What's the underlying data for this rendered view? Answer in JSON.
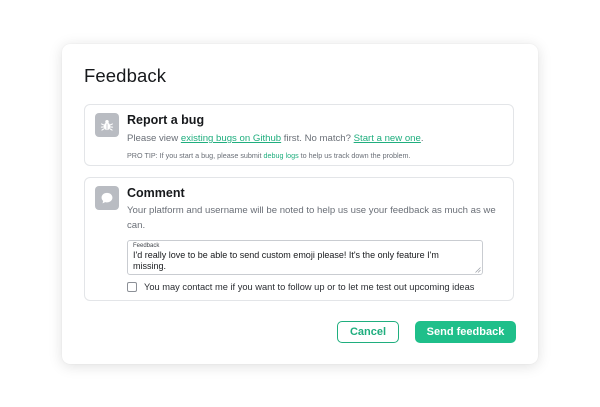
{
  "dialog": {
    "title": "Feedback"
  },
  "bug_card": {
    "icon": "bug-icon",
    "title": "Report a bug",
    "line_prefix": "Please view ",
    "existing_link": "existing bugs on Github",
    "line_middle": " first. No match? ",
    "new_link": "Start a new one",
    "line_suffix": ".",
    "protip_prefix": "PRO TIP: If you start a bug, please submit ",
    "protip_link": "debug logs",
    "protip_suffix": " to help us track down the problem."
  },
  "comment_card": {
    "icon": "speech-bubble-icon",
    "title": "Comment",
    "description": "Your platform and username will be noted to help us use your feedback as much as we can.",
    "feedback_label": "Feedback",
    "feedback_value": "I'd really love to be able to send custom emoji please! It's the only feature I'm missing.",
    "contact_label": "You may contact me if you want to follow up or to let me test out upcoming ideas",
    "contact_checked": false
  },
  "actions": {
    "cancel_label": "Cancel",
    "send_label": "Send feedback"
  },
  "colors": {
    "accent": "#1fbf8a",
    "link": "#1fae7e",
    "icon_bg": "#b9bcc2"
  }
}
